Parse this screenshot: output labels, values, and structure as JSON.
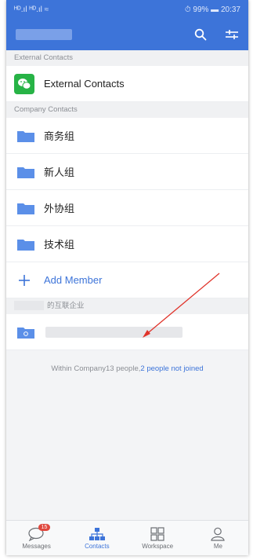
{
  "status_bar": {
    "signal": "ᴴᴰ.ıl ᴴᴰ.ıl ≈",
    "right": "⏱ 99% ▬ 20:37"
  },
  "header": {
    "title_blurred": true,
    "search_icon": "search-icon",
    "filter_icon": "filter-icon"
  },
  "sections": {
    "external_header": "External Contacts",
    "external_item": "External Contacts",
    "company_header": "Company Contacts",
    "groups": [
      "商务组",
      "新人组",
      "外协组",
      "技术组"
    ],
    "add_member": "Add Member",
    "partner_header": "的互联企业"
  },
  "summary": {
    "prefix": "Within Company13 people,",
    "link": "2 people not joined"
  },
  "tabs": [
    {
      "label": "Messages",
      "badge": "15"
    },
    {
      "label": "Contacts"
    },
    {
      "label": "Workspace"
    },
    {
      "label": "Me"
    }
  ],
  "colors": {
    "accent": "#3d74d9",
    "wechat_green": "#27b346",
    "badge_red": "#e0483e",
    "arrow_red": "#e0332a"
  }
}
